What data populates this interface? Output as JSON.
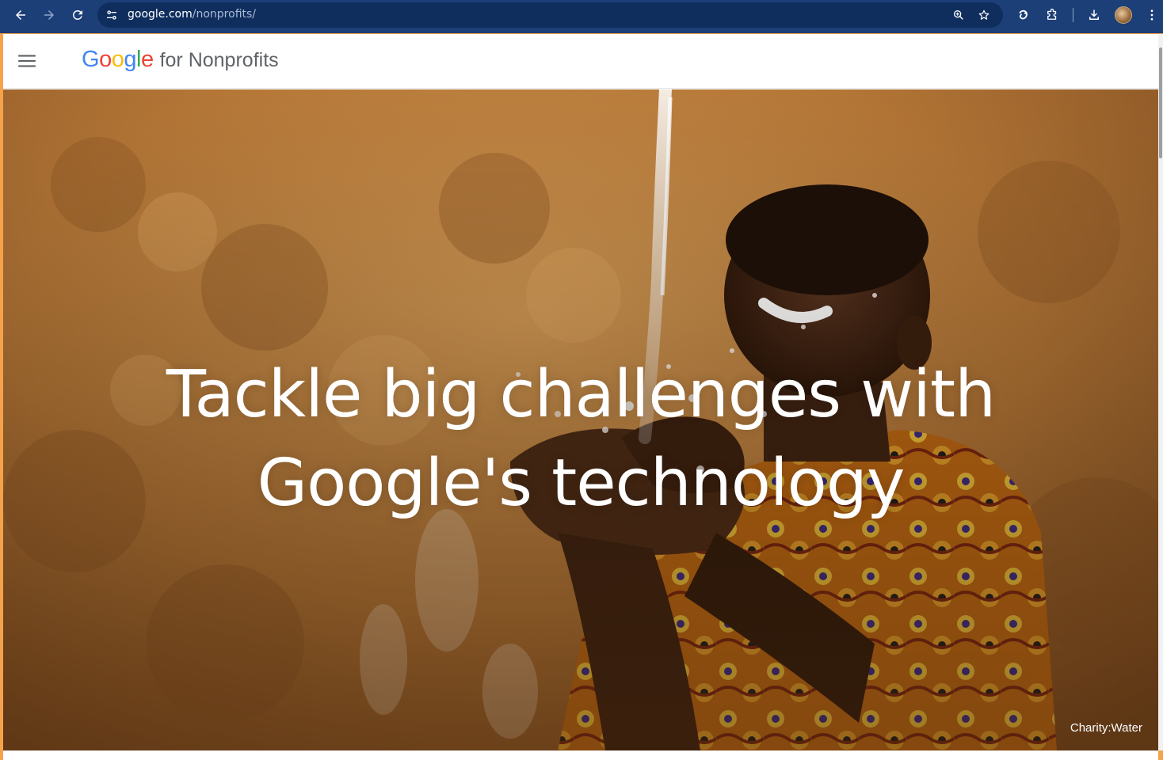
{
  "browser": {
    "url_host": "google.com",
    "url_path": "/nonprofits/",
    "icons": {
      "back": "arrow-left-icon",
      "forward": "arrow-right-icon",
      "reload": "reload-icon",
      "site_info": "tune-icon",
      "zoom": "zoom-icon",
      "bookmark": "star-icon",
      "extension_pinned": "extension-pin-icon",
      "extensions": "puzzle-icon",
      "downloads": "download-icon",
      "profile": "avatar",
      "menu": "kebab-icon"
    },
    "colors": {
      "toolbar": "#1d3f78",
      "omnibox": "#0f2e5e"
    }
  },
  "header": {
    "menu_icon": "hamburger-icon",
    "brand_letters": [
      "G",
      "o",
      "o",
      "g",
      "l",
      "e"
    ],
    "brand_suffix": "for Nonprofits"
  },
  "hero": {
    "title_line1": "Tackle big challenges with",
    "title_line2": "Google's technology",
    "credit": "Charity:Water"
  }
}
